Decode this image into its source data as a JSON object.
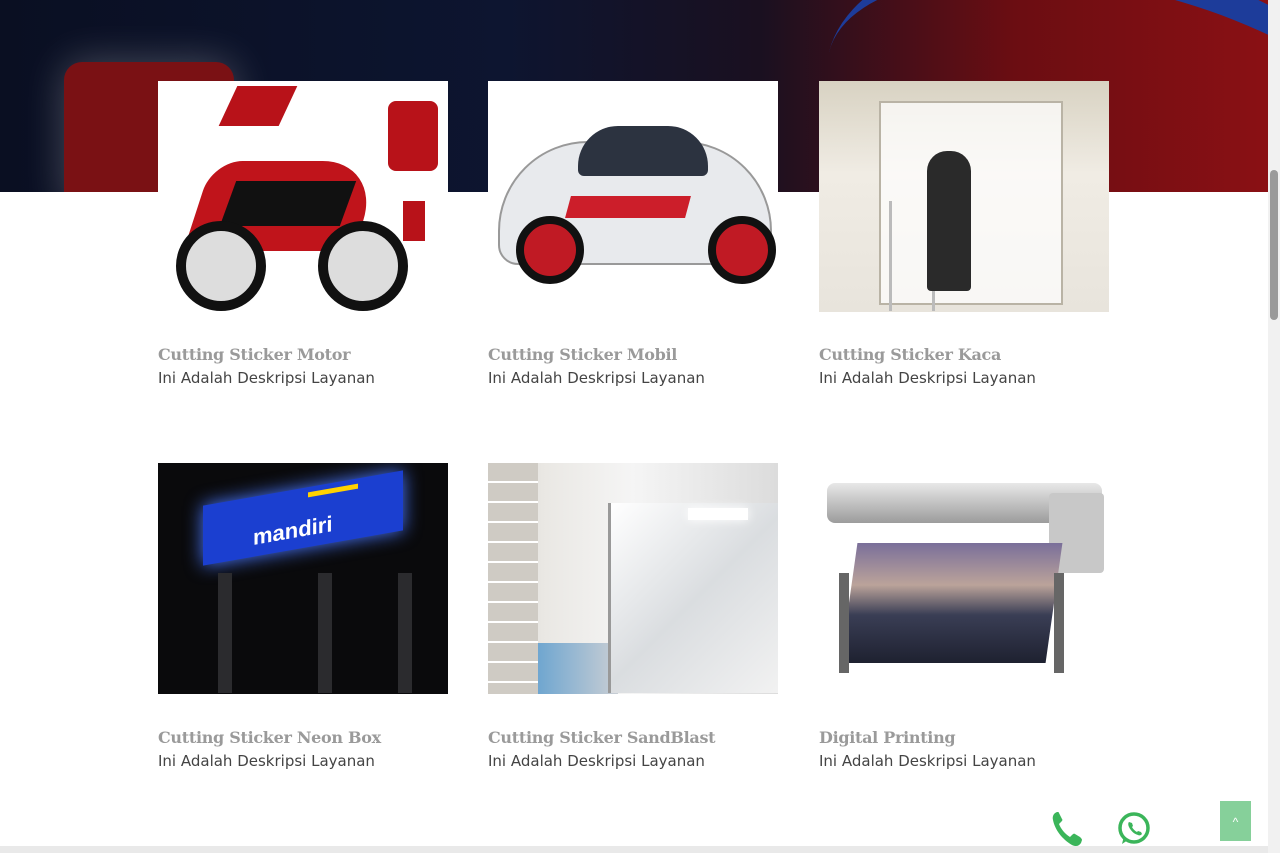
{
  "services": [
    {
      "title": "Cutting Sticker Motor",
      "description": "Ini Adalah Deskripsi Layanan"
    },
    {
      "title": "Cutting Sticker Mobil",
      "description": "Ini Adalah Deskripsi Layanan"
    },
    {
      "title": "Cutting Sticker Kaca",
      "description": "Ini Adalah Deskripsi Layanan"
    },
    {
      "title": "Cutting Sticker Neon Box",
      "description": "Ini Adalah Deskripsi Layanan"
    },
    {
      "title": "Cutting Sticker SandBlast",
      "description": "Ini Adalah Deskripsi Layanan"
    },
    {
      "title": "Digital Printing",
      "description": "Ini Adalah Deskripsi Layanan"
    }
  ],
  "images": {
    "neon_sign_text": "mandiri"
  },
  "floating_contact": {
    "phone_icon": "phone-icon",
    "whatsapp_icon": "whatsapp-icon"
  },
  "back_to_top": {
    "label": "^"
  },
  "colors": {
    "title_gray": "#9a9a9a",
    "desc_text": "#444444",
    "contact_green": "#3bb55a",
    "back_top_bg": "#86d09a"
  }
}
